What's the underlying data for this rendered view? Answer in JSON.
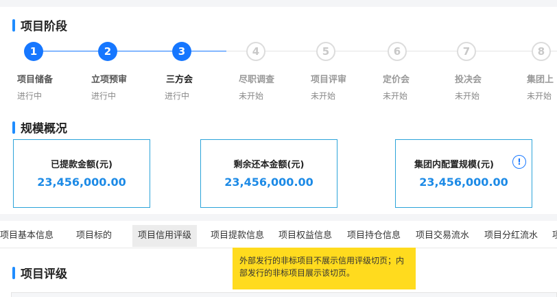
{
  "stage_section": {
    "title": "项目阶段"
  },
  "steps": [
    {
      "num": "1",
      "name": "项目储备",
      "status": "进行中",
      "state": "active"
    },
    {
      "num": "2",
      "name": "立项预审",
      "status": "进行中",
      "state": "active"
    },
    {
      "num": "3",
      "name": "三方会",
      "status": "进行中",
      "state": "current"
    },
    {
      "num": "4",
      "name": "尽职调查",
      "status": "未开始",
      "state": "pending"
    },
    {
      "num": "5",
      "name": "项目评审",
      "status": "未开始",
      "state": "pending"
    },
    {
      "num": "6",
      "name": "定价会",
      "status": "未开始",
      "state": "pending"
    },
    {
      "num": "7",
      "name": "投决会",
      "status": "未开始",
      "state": "pending"
    },
    {
      "num": "8",
      "name": "集团上",
      "status": "未开始",
      "state": "pending"
    }
  ],
  "scale_section": {
    "title": "规模概况"
  },
  "stats": [
    {
      "label": "已提款金额(元)",
      "value": "23,456,000.00"
    },
    {
      "label": "剩余还本金额(元)",
      "value": "23,456,000.00"
    },
    {
      "label": "集团内配置规模(元)",
      "value": "23,456,000.00",
      "info_icon": "!"
    }
  ],
  "tabs": [
    {
      "label": "项目基本信息"
    },
    {
      "label": "项目标的"
    },
    {
      "label": "项目信用评级",
      "selected": true
    },
    {
      "label": "项目提款信息"
    },
    {
      "label": "项目权益信息"
    },
    {
      "label": "项目持仓信息"
    },
    {
      "label": "项目交易流水"
    },
    {
      "label": "项目分红流水"
    },
    {
      "label": "项"
    }
  ],
  "rating_section": {
    "title": "项目评级"
  },
  "tooltip": {
    "text": "外部发行的非标项目不展示信用评级切页；内部发行的非标项目展示该切页。"
  },
  "colors": {
    "accent": "#1677ff",
    "value": "#1c8ae6",
    "stat_border": "#2aa3d9",
    "tooltip_bg": "#ffdb1e"
  },
  "icons": {
    "stat_info": "info-circle-icon"
  }
}
